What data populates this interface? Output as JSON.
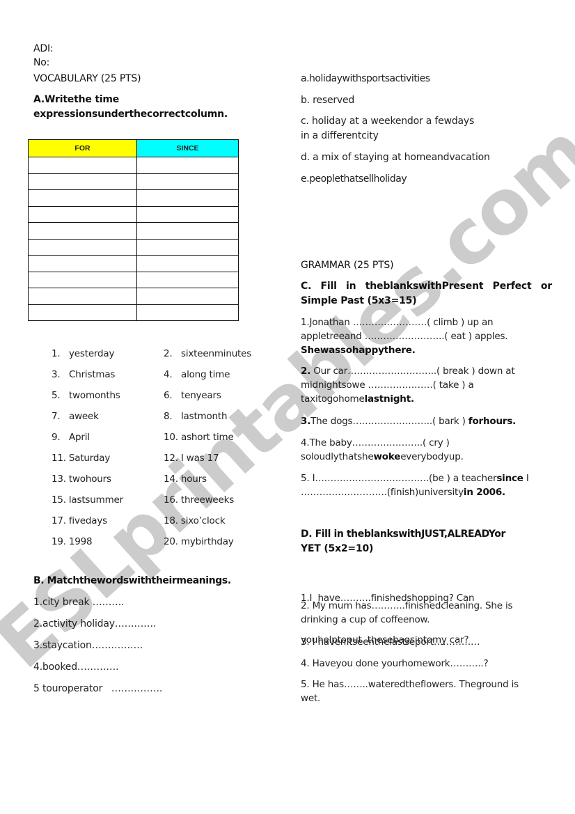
{
  "header": {
    "name_label": "ADI:",
    "number_label": "No:",
    "vocab_title": "VOCABULARY (25 PTS)"
  },
  "section_a": {
    "instruction_line1": "A.Writethe time",
    "instruction_line2": "expressionsunderthecorrectcolumn.",
    "table": {
      "headers": [
        "FOR",
        "SINCE"
      ],
      "header_colors": [
        "#ffff00",
        "#00ffff"
      ],
      "empty_rows": 10
    },
    "items": [
      {
        "n": "1.",
        "text": "yesterday"
      },
      {
        "n": "2.",
        "text": "sixteenminutes"
      },
      {
        "n": "3.",
        "text": "Christmas"
      },
      {
        "n": "4.",
        "text": "along time"
      },
      {
        "n": "5.",
        "text": "twomonths"
      },
      {
        "n": "6.",
        "text": "tenyears"
      },
      {
        "n": "7.",
        "text": "aweek"
      },
      {
        "n": "8.",
        "text": "lastmonth"
      },
      {
        "n": "9.",
        "text": "April"
      },
      {
        "n": "10.",
        "text": "ashort time"
      },
      {
        "n": "11.",
        "text": "Saturday"
      },
      {
        "n": "12.",
        "text": "I was 17"
      },
      {
        "n": "13.",
        "text": "twohours"
      },
      {
        "n": "14.",
        "text": "hours"
      },
      {
        "n": "15.",
        "text": "lastsummer"
      },
      {
        "n": "16.",
        "text": "threeweeks"
      },
      {
        "n": "17.",
        "text": "fivedays"
      },
      {
        "n": "18.",
        "text": "sixo’clock"
      },
      {
        "n": "19.",
        "text": "1998"
      },
      {
        "n": "20.",
        "text": "mybirthday"
      }
    ]
  },
  "section_b": {
    "instruction": "B. Matchthewordswiththeirmeanings.",
    "words": [
      "1.city break  ……….",
      "2.activity holiday………….",
      "3.staycation…………….",
      "4.booked………….",
      "5 touroperator   ……………."
    ],
    "meanings": [
      "a.holidaywithsportsactivities",
      "b. reserved",
      "c. holiday at a weekendor a fewdays",
      "in a differentcity",
      "d. a mix of staying at homeandvacation",
      "e.peoplethatsellholiday"
    ]
  },
  "grammar": {
    "title": "GRAMMAR (25 PTS)",
    "section_c": {
      "instruction_line1": "C.  Fill  in  theblankswithPresent  Perfect  or",
      "instruction_line2": "Simple Past (5x3=15)",
      "q1": {
        "l1": "1.Jonathan ……………………( climb ) up an",
        "l2": "appletreeand ……………………..( eat ) apples.",
        "l3_bold": "Shewassohappythere."
      },
      "q2": {
        "num": "2.",
        "l1": " Our car………………………..( break ) down at",
        "l2": "midnightsowe …………………( take ) a",
        "l3": "taxitogohome",
        "l3_bold": "lastnight."
      },
      "q3": {
        "num": "3.",
        "l1": "The dogs……………………..( bark ) ",
        "l1_bold": "forhours."
      },
      "q4": {
        "l1": "4.The baby…………………..( cry )",
        "l2a": "soloudlythatshe",
        "l2_bold": "woke",
        "l2b": "everybodyup."
      },
      "q5": {
        "l1a": "5. I……………………………….(be ) a teacher",
        "l1_bold": "since",
        "l1b": " I",
        "l2a": "……………………….(finish)university",
        "l2_bold": "in 2006."
      }
    },
    "section_d": {
      "instruction_line1": "D. Fill in theblankswithJUST,ALREADYor",
      "instruction_line2": "YET (5x2=10)",
      "q1_l1": "1.I  have……….finishedshopping? Can",
      "q1_l2": "youhelptoput  thesebagsintomy car?",
      "q2_l1": "2. My mum has………..finishedcleaning. She is",
      "q2_l2": "drinking a cup of coffeenow.",
      "q3": "3. I haven’tseenthelastreport……………",
      "q4": "4. Haveyou done yourhomework………..?",
      "q5_l1": "5. He has……..wateredtheflowers. Theground is",
      "q5_l2": "wet."
    }
  },
  "watermark": {
    "text": "ESLprintables.com",
    "color": "#c4c4c4"
  }
}
